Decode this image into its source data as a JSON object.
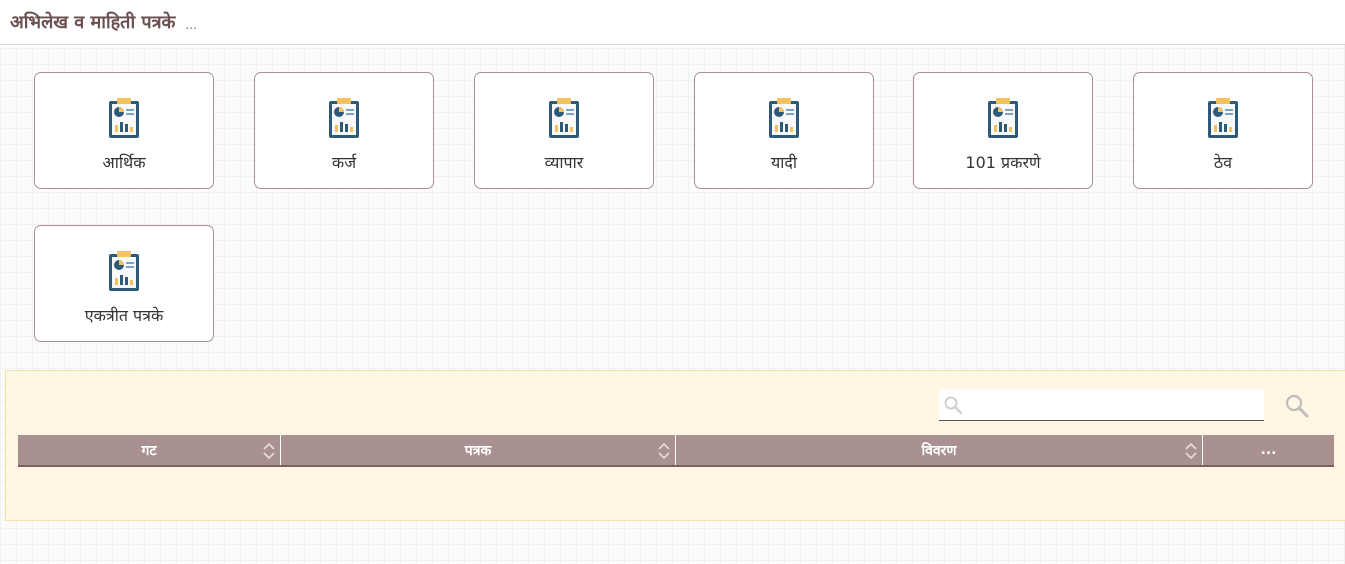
{
  "header": {
    "title": "अभिलेख व माहिती पत्रके",
    "ellipsis": "..."
  },
  "tiles": [
    {
      "label": "आर्थिक"
    },
    {
      "label": "कर्ज"
    },
    {
      "label": "व्यापार"
    },
    {
      "label": "यादी"
    },
    {
      "label": "101 प्रकरणे"
    },
    {
      "label": "ठेव"
    },
    {
      "label": "एकत्रीत पत्रके"
    }
  ],
  "search": {
    "value": "",
    "placeholder": ""
  },
  "table": {
    "columns": [
      {
        "label": "गट"
      },
      {
        "label": "पत्रक"
      },
      {
        "label": "विवरण"
      },
      {
        "label": "..."
      }
    ],
    "rows": []
  },
  "colors": {
    "tile_border": "#a89191",
    "table_header": "#a99191",
    "panel_bg": "#fff7e3",
    "title": "#6b5050"
  },
  "icons": {
    "tile": "report-clipboard-icon",
    "search": "search-icon",
    "sort": "sort-icon"
  }
}
